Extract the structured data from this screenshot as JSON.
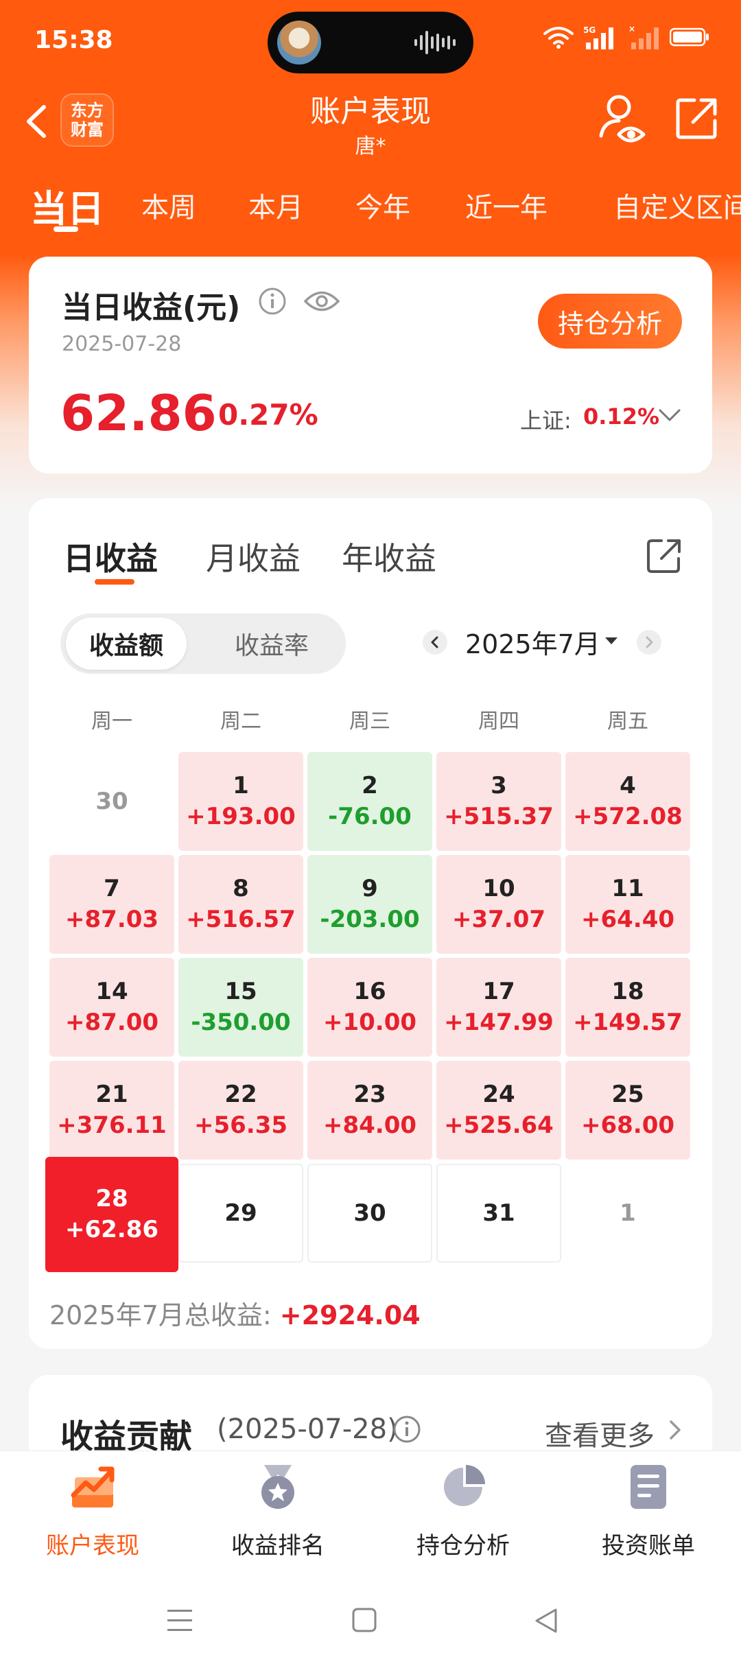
{
  "status": {
    "time": "15:38",
    "network": "5G"
  },
  "header": {
    "logo_line1": "东方",
    "logo_line2": "财富",
    "title": "账户表现",
    "subtitle": "唐*"
  },
  "period_tabs": [
    "当日",
    "本周",
    "本月",
    "今年",
    "近一年",
    "自定义区间"
  ],
  "daily": {
    "title": "当日收益(元)",
    "date": "2025-07-28",
    "hold_button": "持仓分析",
    "amount": "62.86",
    "rate": "0.27%",
    "index_label": "上证:",
    "index_value": "0.12%"
  },
  "earnings": {
    "tabs": [
      "日收益",
      "月收益",
      "年收益"
    ],
    "segments": [
      "收益额",
      "收益率"
    ],
    "month": "2025年7月",
    "weekdays": [
      "周一",
      "周二",
      "周三",
      "周四",
      "周五"
    ],
    "weeks": [
      [
        {
          "day": "30",
          "value": "",
          "type": "other"
        },
        {
          "day": "1",
          "value": "+193.00",
          "type": "gain"
        },
        {
          "day": "2",
          "value": "-76.00",
          "type": "loss"
        },
        {
          "day": "3",
          "value": "+515.37",
          "type": "gain"
        },
        {
          "day": "4",
          "value": "+572.08",
          "type": "gain"
        }
      ],
      [
        {
          "day": "7",
          "value": "+87.03",
          "type": "gain"
        },
        {
          "day": "8",
          "value": "+516.57",
          "type": "gain"
        },
        {
          "day": "9",
          "value": "-203.00",
          "type": "loss"
        },
        {
          "day": "10",
          "value": "+37.07",
          "type": "gain"
        },
        {
          "day": "11",
          "value": "+64.40",
          "type": "gain"
        }
      ],
      [
        {
          "day": "14",
          "value": "+87.00",
          "type": "gain"
        },
        {
          "day": "15",
          "value": "-350.00",
          "type": "loss"
        },
        {
          "day": "16",
          "value": "+10.00",
          "type": "gain"
        },
        {
          "day": "17",
          "value": "+147.99",
          "type": "gain"
        },
        {
          "day": "18",
          "value": "+149.57",
          "type": "gain"
        }
      ],
      [
        {
          "day": "21",
          "value": "+376.11",
          "type": "gain"
        },
        {
          "day": "22",
          "value": "+56.35",
          "type": "gain"
        },
        {
          "day": "23",
          "value": "+84.00",
          "type": "gain"
        },
        {
          "day": "24",
          "value": "+525.64",
          "type": "gain"
        },
        {
          "day": "25",
          "value": "+68.00",
          "type": "gain"
        }
      ],
      [
        {
          "day": "28",
          "value": "+62.86",
          "type": "today"
        },
        {
          "day": "29",
          "value": "",
          "type": "empty"
        },
        {
          "day": "30",
          "value": "",
          "type": "empty"
        },
        {
          "day": "31",
          "value": "",
          "type": "empty"
        },
        {
          "day": "1",
          "value": "",
          "type": "other"
        }
      ]
    ],
    "total_label": "2025年7月总收益:",
    "total_value": "+2924.04"
  },
  "contribution": {
    "title": "收益贡献",
    "date": "(2025-07-28)",
    "more": "查看更多"
  },
  "tabbar": [
    {
      "label": "账户表现",
      "icon": "trend-chart-icon",
      "active": true
    },
    {
      "label": "收益排名",
      "icon": "medal-icon",
      "active": false
    },
    {
      "label": "持仓分析",
      "icon": "pie-chart-icon",
      "active": false
    },
    {
      "label": "投资账单",
      "icon": "bill-icon",
      "active": false
    }
  ],
  "colors": {
    "brand": "#ff5a14",
    "gain": "#e6202c",
    "loss": "#1e9e2e",
    "today": "#f01f2a"
  }
}
